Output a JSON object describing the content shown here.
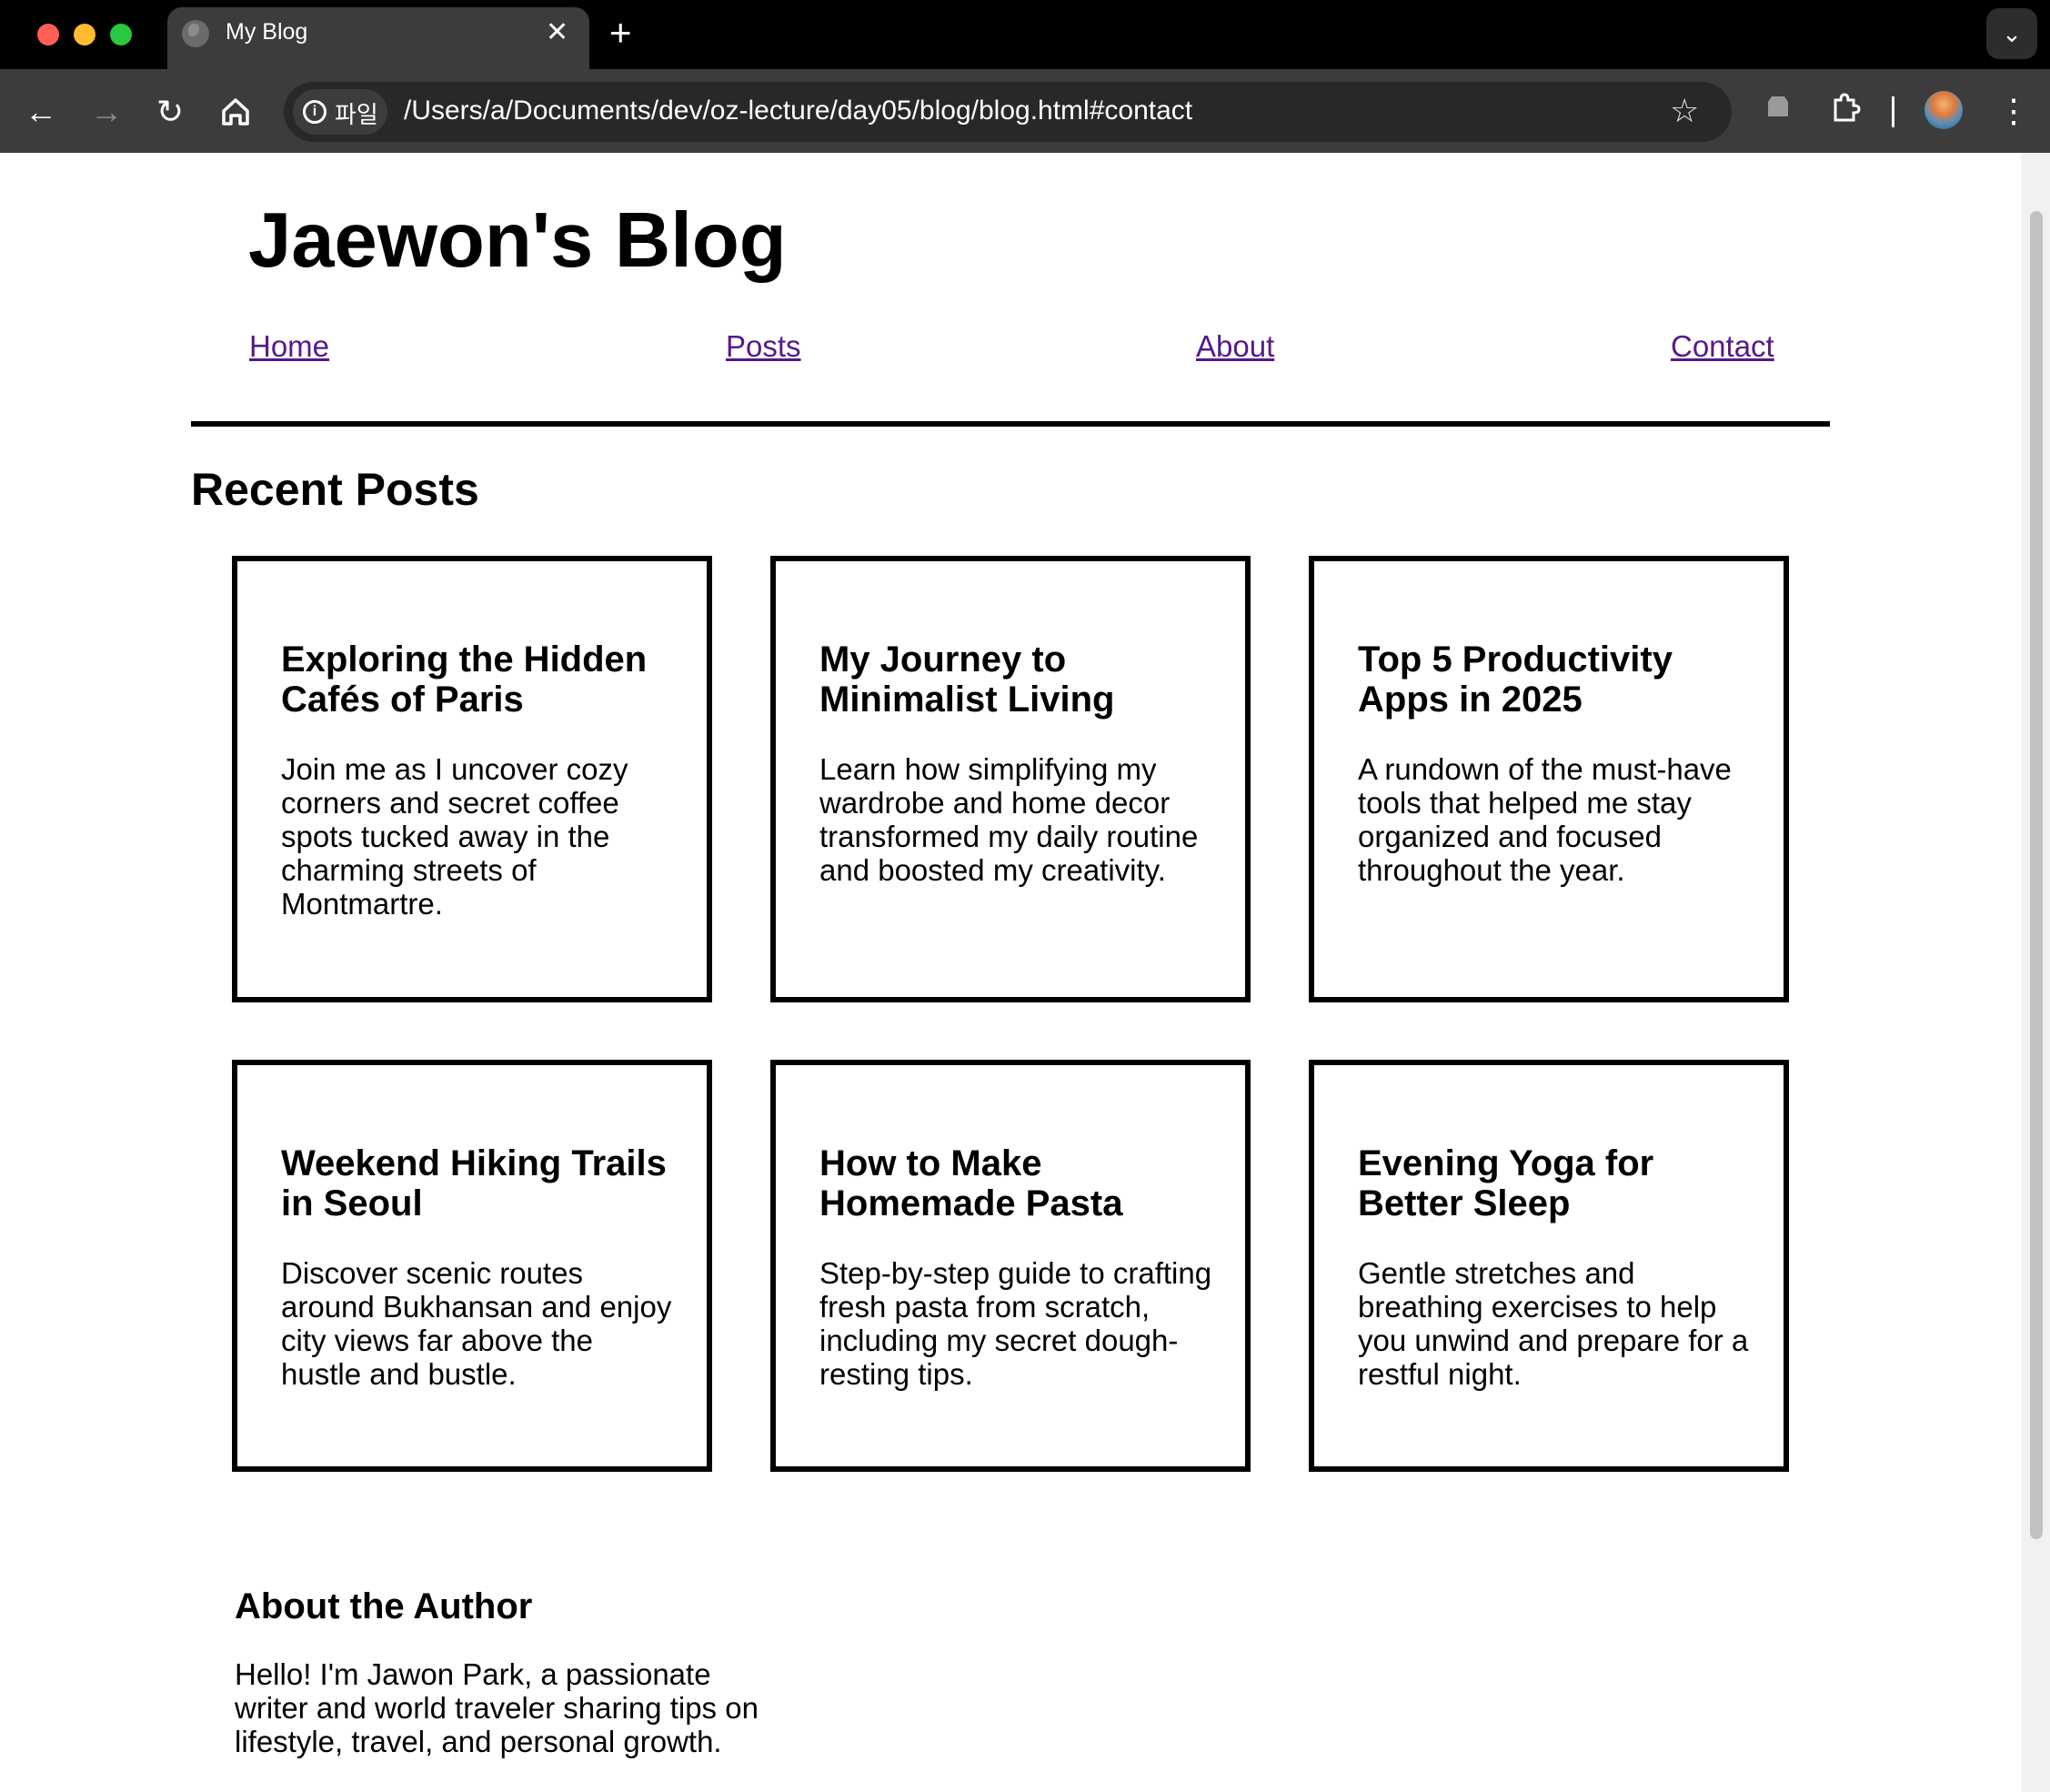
{
  "browser": {
    "tab_title": "My Blog",
    "chip_label": "파일",
    "url": "/Users/a/Documents/dev/oz-lecture/day05/blog/blog.html#contact",
    "icons": [
      "back-icon",
      "forward-icon",
      "reload-icon",
      "home-icon",
      "info-icon",
      "star-icon",
      "extension-icon",
      "kebab-menu-icon"
    ]
  },
  "page": {
    "blog_title": "Jaewon's Blog",
    "nav": [
      "Home",
      "Posts",
      "About",
      "Contact"
    ],
    "section_title": "Recent Posts",
    "posts": [
      {
        "title": "Exploring the Hidden Cafés of Paris",
        "excerpt": "Join me as I uncover cozy corners and secret coffee spots tucked away in the charming streets of Montmartre."
      },
      {
        "title": "My Journey to Minimalist Living",
        "excerpt": "Learn how simplifying my wardrobe and home decor transformed my daily routine and boosted my creativity."
      },
      {
        "title": "Top 5 Productivity Apps in 2025",
        "excerpt": "A rundown of the must-have tools that helped me stay organized and focused throughout the year."
      },
      {
        "title": "Weekend Hiking Trails in Seoul",
        "excerpt": "Discover scenic routes around Bukhansan and enjoy city views far above the hustle and bustle."
      },
      {
        "title": "How to Make Homemade Pasta",
        "excerpt": "Step-by-step guide to crafting fresh pasta from scratch, including my secret dough-resting tips."
      },
      {
        "title": "Evening Yoga for Better Sleep",
        "excerpt": "Gentle stretches and breathing exercises to help you unwind and prepare for a restful night."
      }
    ],
    "about": {
      "title": "About the Author",
      "text": "Hello! I'm Jawon Park, a passionate writer and world traveler sharing tips on lifestyle, travel, and personal growth."
    }
  },
  "colors": {
    "link": "#1a0dab",
    "link_visited": "#551a8b",
    "chrome_bg": "#000000",
    "toolbar_bg": "#3c3c3c"
  }
}
